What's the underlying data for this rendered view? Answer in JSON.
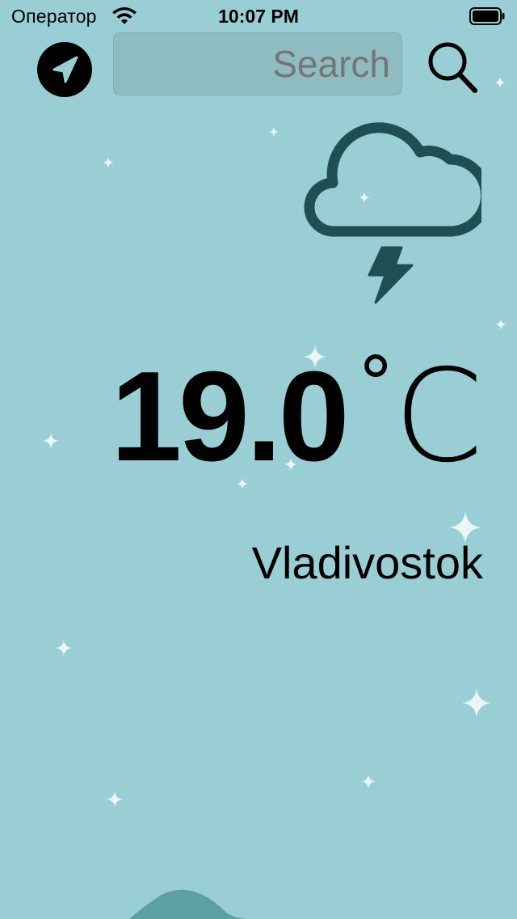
{
  "status_bar": {
    "carrier": "Оператор",
    "time": "10:07 PM",
    "wifi_icon": "wifi-icon",
    "battery_icon": "battery-icon"
  },
  "nav": {
    "location_icon": "location-arrow-icon",
    "search_placeholder": "Search",
    "search_icon": "magnifier-icon"
  },
  "weather": {
    "condition_icon": "cloud-bolt-icon",
    "temperature": "19.0",
    "degree_symbol": "°",
    "unit": "C",
    "city": "Vladivostok"
  },
  "colors": {
    "background": "#99cfd4",
    "icon_dark_teal": "#1f4f55",
    "sparkle": "#eaf6f7",
    "hill": "#5e9fa4"
  }
}
